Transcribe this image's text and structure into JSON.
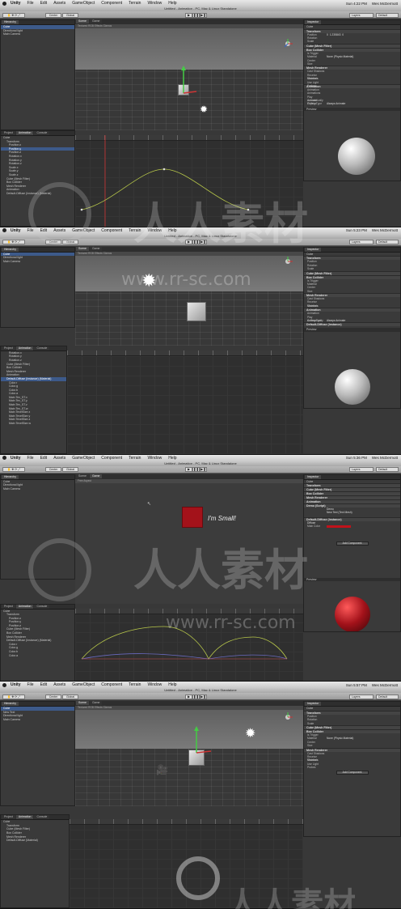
{
  "frames": [
    {
      "menu": {
        "app": "Unity",
        "items": [
          "File",
          "Edit",
          "Assets",
          "GameObject",
          "Component",
          "Terrain",
          "Window",
          "Help"
        ],
        "time": "Sun 4:22 PM",
        "user": "Wes McDermott"
      },
      "title": "Untitled - Animation - PC, Mac & Linux Standalone",
      "toolbar": {
        "center": "Center",
        "global": "Global",
        "layers": "Layers",
        "layout": "Default"
      },
      "hierarchy": {
        "tab": "Hierarchy",
        "items": [
          "Cube",
          "Directional light",
          "Main Camera"
        ]
      },
      "scene": {
        "tab_scene": "Scene",
        "tab_game": "Game",
        "bar": "Textured   RGB   Effects   Gizmos"
      },
      "animation": {
        "tabs": [
          "Project",
          "Animation",
          "Console"
        ],
        "props": [
          "Cube",
          "Transform",
          "Position.x",
          "Position.y",
          "Position.z",
          "Rotation.x",
          "Rotation.y",
          "Rotation.z",
          "Scale.x",
          "Scale.y",
          "Scale.z",
          "Cube (Mesh Filter)",
          "Box Collider",
          "Mesh Renderer",
          "Animation",
          "Default-Diffuse (Instance) (Material)"
        ]
      },
      "inspector": {
        "tab": "Inspector",
        "object": "Cube",
        "sections": [
          "Transform",
          "Cube (Mesh Filter)",
          "Box Collider",
          "Mesh Renderer",
          "Animation"
        ],
        "fields": [
          "Position",
          "Rotation",
          "Scale",
          "Is Trigger",
          "Material",
          "Center",
          "Size",
          "Cast Shadows",
          "Receive Shadows",
          "Materials",
          "Use Light Probes",
          "Animation",
          "Animations",
          "Play Automatically",
          "Animate Physics",
          "Culling Type"
        ],
        "pos_x": "0",
        "pos_y": "1.235843",
        "pos_z": "0",
        "culling": "Always Animate",
        "material_val": "None (Physic Material)",
        "preview": "Preview"
      }
    },
    {
      "menu": {
        "time": "Sun 5:23 PM",
        "user": "Wes McDermott"
      },
      "title": "Untitled - Animation - PC, Mac & Linux Standalone",
      "hierarchy": {
        "items": [
          "Cube",
          "Directional light",
          "Main Camera"
        ]
      },
      "animation": {
        "props": [
          "Rotation.x",
          "Rotation.y",
          "Rotation.z",
          "Cube (Mesh Filter)",
          "Box Collider",
          "Mesh Renderer",
          "Animation",
          "Default-Diffuse (Instance) (Material)",
          "Color.r",
          "Color.g",
          "Color.b",
          "Color.a",
          "Main Tex_ST.x",
          "Main Tex_ST.y",
          "Main Tex_ST.z",
          "Main Tex_ST.w",
          "Main TexelSize.x",
          "Main TexelSize.y",
          "Main TexelSize.z",
          "Main TexelSize.w"
        ]
      },
      "inspector": {
        "sections": [
          "Transform",
          "Cube (Mesh Filter)",
          "Box Collider",
          "Mesh Renderer",
          "Animation",
          "Default-Diffuse (Instance)"
        ],
        "culling": "Always Animate",
        "preview": "Preview"
      }
    },
    {
      "menu": {
        "time": "Sun 5:36 PM",
        "user": "Wes McDermott"
      },
      "title": "Untitled - Animation - PC, Mac & Linux Standalone",
      "hierarchy": {
        "items": [
          "Cube",
          "Directional light",
          "Main Camera"
        ]
      },
      "game": {
        "text": "I'm Small!",
        "bar": "Free Aspect"
      },
      "animation": {
        "props": [
          "Cube",
          "Transform",
          "Position.x",
          "Position.y",
          "Position.z",
          "Cube (Mesh Filter)",
          "Box Collider",
          "Mesh Renderer",
          "Default-Diffuse (Instance) (Material)",
          "Color.r",
          "Color.g",
          "Color.b",
          "Color.a"
        ]
      },
      "inspector": {
        "sections": [
          "Transform",
          "Cube (Mesh Filter)",
          "Box Collider",
          "Mesh Renderer",
          "Animation",
          "Demo (Script)",
          "Default-Diffuse (Instance)"
        ],
        "script_val": "Demo",
        "text_val": "New Text (Text Mesh)",
        "shader": "Diffuse",
        "main_color": "Main Color",
        "add_component": "Add Component",
        "preview": "Preview"
      }
    },
    {
      "menu": {
        "time": "Sun 5:57 PM",
        "user": "Wes McDermott"
      },
      "title": "Untitled - Animation - PC, Mac & Linux Standalone",
      "hierarchy": {
        "items": [
          "Cube",
          "New Text",
          "Directional light",
          "Main Camera"
        ]
      },
      "animation": {
        "props": [
          "Cube",
          "Transform",
          "Cube (Mesh Filter)",
          "Box Collider",
          "Mesh Renderer",
          "Default-Diffuse (Material)"
        ]
      },
      "inspector": {
        "sections": [
          "Transform",
          "Cube (Mesh Filter)",
          "Box Collider",
          "Mesh Renderer"
        ],
        "add_component": "Add Component"
      }
    }
  ],
  "watermark": {
    "text": "人人素材",
    "url": "www.rr-sc.com"
  },
  "colors": {
    "selection": "#3d5a8a",
    "curve": "#b8c84a",
    "red_object": "#a3121a"
  }
}
